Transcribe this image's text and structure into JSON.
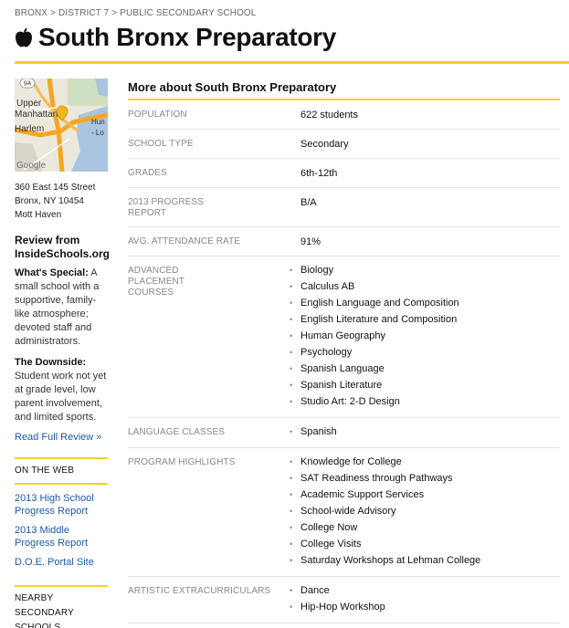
{
  "breadcrumb": {
    "items": [
      "BRONX",
      "DISTRICT 7",
      "PUBLIC SECONDARY SCHOOL"
    ],
    "separator": ">"
  },
  "page": {
    "title": "South Bronx Preparatory",
    "accent_color": "#f3d22a",
    "link_color": "#1a5aa6"
  },
  "map": {
    "labels": [
      "9A",
      "Upper",
      "Manhattan",
      "Harlem",
      "Hun",
      "- Lo",
      "Google"
    ]
  },
  "address": {
    "line1": "360 East 145 Street",
    "line2": "Bronx, NY 10454",
    "neighborhood": "Mott Haven"
  },
  "review": {
    "heading": "Review from InsideSchools.org",
    "special_label": "What's Special:",
    "special_text": " A small school with a supportive, family-like atmosphere; devoted staff and administrators.",
    "downside_label": "The Downside:",
    "downside_text": "Student work not yet at grade level, low parent involvement, and limited sports.",
    "link_label": "Read Full Review »"
  },
  "on_the_web": {
    "heading": "ON THE WEB",
    "links": [
      "2013 High School Progress Report",
      "2013 Middle Progress Report",
      "D.O.E. Portal Site"
    ]
  },
  "nearby": {
    "heading": "NEARBY SECONDARY SCHOOLS"
  },
  "main": {
    "heading": "More about South Bronx Preparatory",
    "rows": [
      {
        "key": "POPULATION",
        "value": "622 students"
      },
      {
        "key": "SCHOOL TYPE",
        "value": "Secondary"
      },
      {
        "key": "GRADES",
        "value": "6th-12th"
      },
      {
        "key": "2013 PROGRESS REPORT",
        "value": "B/A"
      },
      {
        "key": "AVG. ATTENDANCE RATE",
        "value": "91%"
      }
    ],
    "ap": {
      "key": "ADVANCED PLACEMENT COURSES",
      "items": [
        "Biology",
        "Calculus AB",
        "English Language and Composition",
        "English Literature and Composition",
        "Human Geography",
        "Psychology",
        "Spanish Language",
        "Spanish Literature",
        "Studio Art: 2-D Design"
      ]
    },
    "language": {
      "key": "LANGUAGE CLASSES",
      "items": [
        "Spanish"
      ]
    },
    "program": {
      "key": "PROGRAM HIGHLIGHTS",
      "items": [
        "Knowledge for College",
        "SAT Readiness through Pathways",
        "Academic Support Services",
        "School-wide Advisory",
        "College Now",
        "College Visits",
        "Saturday Workshops at Lehman College"
      ]
    },
    "arts": {
      "key": "ARTISTIC EXTRACURRICULARS",
      "items": [
        "Dance",
        "Hip-Hop Workshop"
      ]
    }
  }
}
